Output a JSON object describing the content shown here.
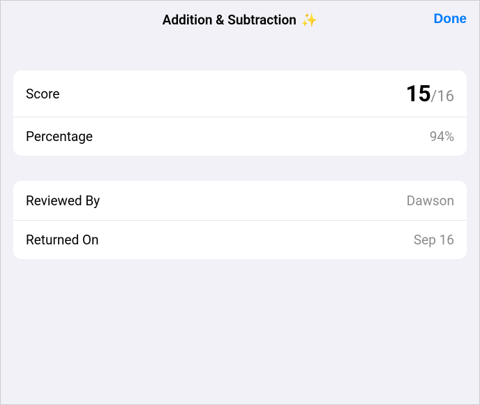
{
  "header": {
    "title": "Addition & Subtraction",
    "sparkle": "✨",
    "done_label": "Done"
  },
  "score_card": {
    "score_label": "Score",
    "score_value": "15",
    "score_total": "/16",
    "percentage_label": "Percentage",
    "percentage_value": "94%"
  },
  "review_card": {
    "reviewed_by_label": "Reviewed By",
    "reviewed_by_value": "Dawson",
    "returned_on_label": "Returned On",
    "returned_on_value": "Sep 16"
  }
}
